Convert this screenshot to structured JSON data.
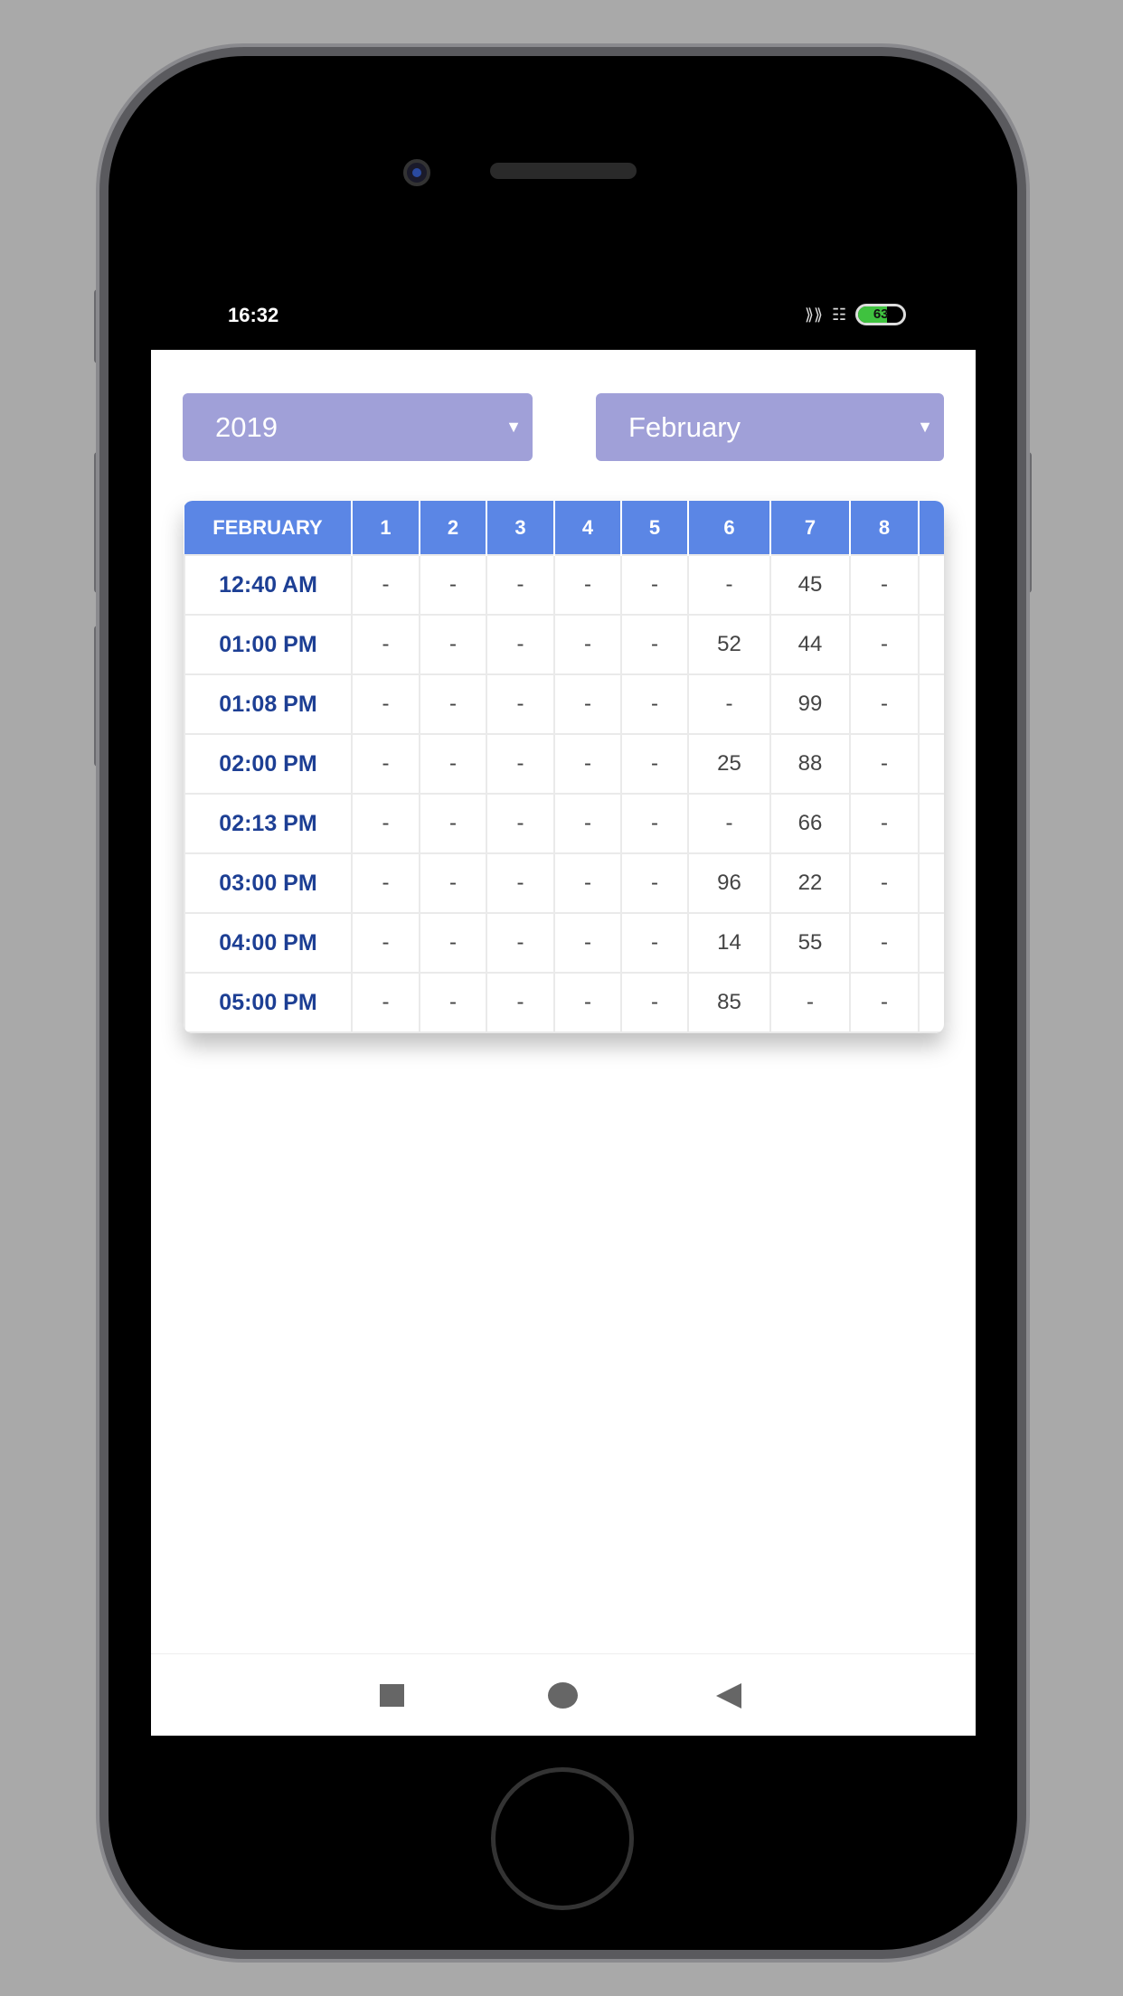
{
  "status_bar": {
    "time": "16:32",
    "battery": "63"
  },
  "filters": {
    "year": "2019",
    "month": "February"
  },
  "table": {
    "header": [
      "FEBRUARY",
      "1",
      "2",
      "3",
      "4",
      "5",
      "6",
      "7",
      "8",
      ""
    ],
    "rows": [
      [
        "12:40 AM",
        "-",
        "-",
        "-",
        "-",
        "-",
        "-",
        "45",
        "-",
        ""
      ],
      [
        "01:00 PM",
        "-",
        "-",
        "-",
        "-",
        "-",
        "52",
        "44",
        "-",
        ""
      ],
      [
        "01:08 PM",
        "-",
        "-",
        "-",
        "-",
        "-",
        "-",
        "99",
        "-",
        ""
      ],
      [
        "02:00 PM",
        "-",
        "-",
        "-",
        "-",
        "-",
        "25",
        "88",
        "-",
        ""
      ],
      [
        "02:13 PM",
        "-",
        "-",
        "-",
        "-",
        "-",
        "-",
        "66",
        "-",
        ""
      ],
      [
        "03:00 PM",
        "-",
        "-",
        "-",
        "-",
        "-",
        "96",
        "22",
        "-",
        ""
      ],
      [
        "04:00 PM",
        "-",
        "-",
        "-",
        "-",
        "-",
        "14",
        "55",
        "-",
        ""
      ],
      [
        "05:00 PM",
        "-",
        "-",
        "-",
        "-",
        "-",
        "85",
        "-",
        "-",
        ""
      ]
    ]
  },
  "colors": {
    "header": "#5b86e5",
    "dropdown": "#a0a0d8",
    "time_text": "#1d3f94"
  }
}
